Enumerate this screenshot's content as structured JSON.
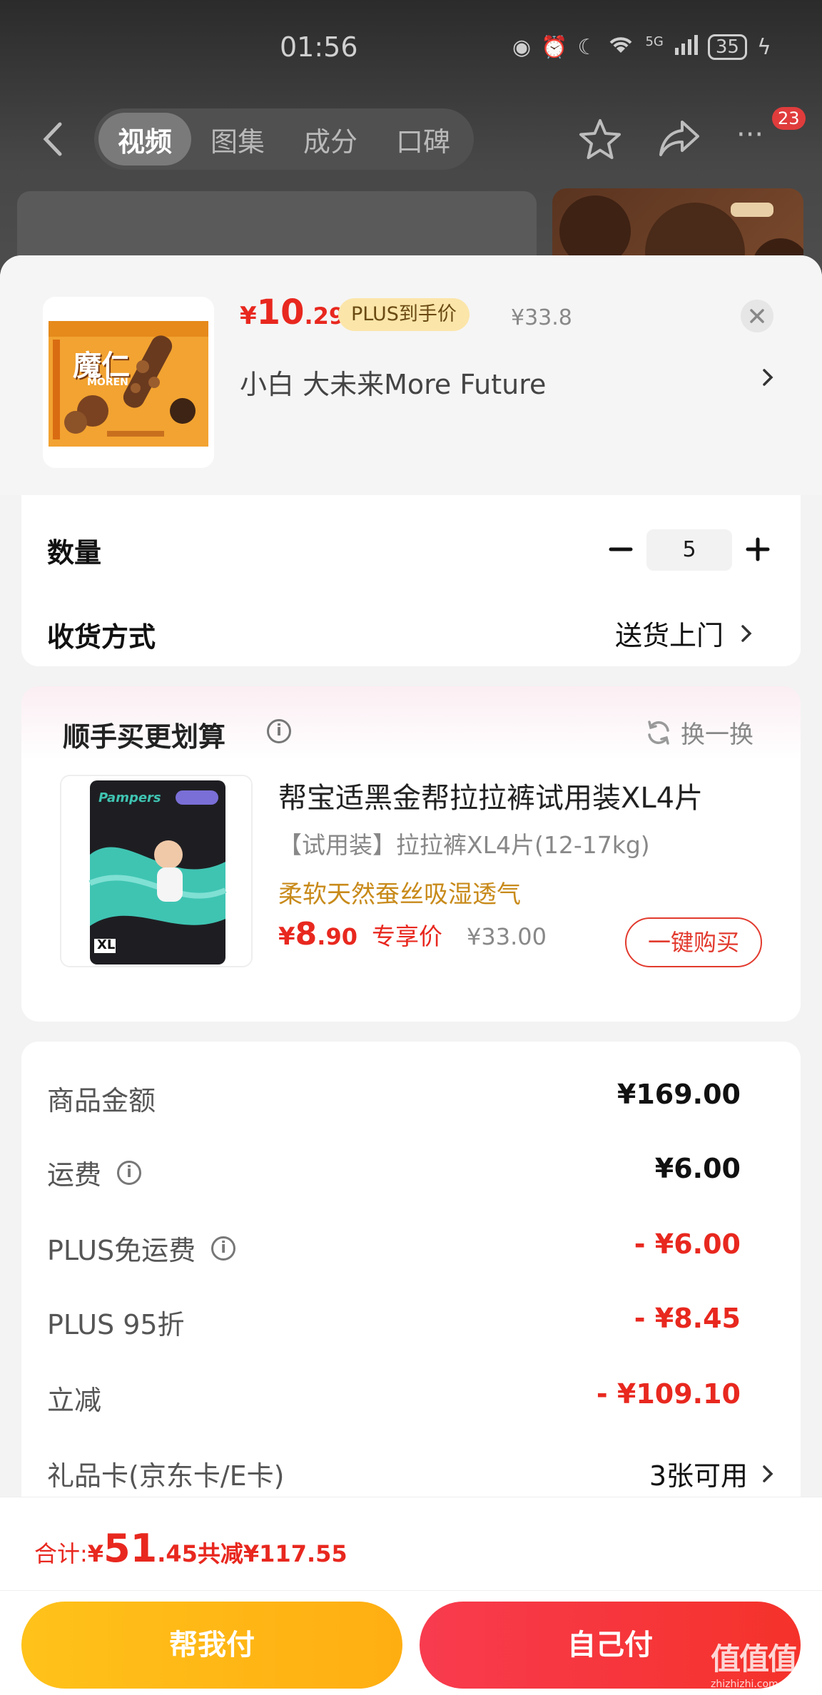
{
  "status_bar": {
    "time": "01:56",
    "battery": "35",
    "network": "5G"
  },
  "nav": {
    "tabs": [
      {
        "label": "视频",
        "active": true
      },
      {
        "label": "图集",
        "active": false
      },
      {
        "label": "成分",
        "active": false
      },
      {
        "label": "口碑",
        "active": false
      }
    ],
    "badge_count": "23"
  },
  "product": {
    "price_currency": "¥",
    "price_int": "10",
    "price_dec": ".29",
    "plus_tag": "PLUS到手价",
    "original_price": "¥33.8",
    "shop": "小白  大未来More Future",
    "image_brand": "魔仁",
    "image_brand_en": "MOREN"
  },
  "order": {
    "quantity_label": "数量",
    "quantity_value": "5",
    "delivery_label": "收货方式",
    "delivery_value": "送货上门"
  },
  "recommend": {
    "title": "顺手买更划算",
    "swap_label": "换一换",
    "item": {
      "name": "帮宝适黑金帮拉拉裤试用装XL4片",
      "spec": "【试用装】拉拉裤XL4片(12-17kg)",
      "feature": "柔软天然蚕丝吸湿透气",
      "price_currency": "¥",
      "price_int": "8",
      "price_dec": ".90",
      "exclusive_label": "专享价",
      "original_price": "¥33.00",
      "buy_label": "一键购买",
      "image_brand": "Pampers",
      "image_size": "XL"
    }
  },
  "costs": [
    {
      "label": "商品金额",
      "value": "¥169.00",
      "info": false,
      "red": false
    },
    {
      "label": "运费",
      "value": "¥6.00",
      "info": true,
      "red": false
    },
    {
      "label": "PLUS免运费",
      "value": "- ¥6.00",
      "info": true,
      "red": true
    },
    {
      "label": "PLUS 95折",
      "value": "- ¥8.45",
      "info": false,
      "red": true
    },
    {
      "label": "立减",
      "value": "- ¥109.10",
      "info": false,
      "red": true
    }
  ],
  "gift_card": {
    "label": "礼品卡(京东卡/E卡)",
    "value": "3张可用"
  },
  "total": {
    "label": "合计: ",
    "currency": "¥",
    "int": "51",
    "dec": ".45",
    "saved": " 共减¥117.55"
  },
  "buttons": {
    "help_pay": "帮我付",
    "self_pay": "自己付"
  },
  "watermark": "值值值",
  "watermark_url": "zhizhizhi.com",
  "colors": {
    "accent_red": "#e8281f",
    "gold": "#ffc21a",
    "plus_tag_bg": "#fbe5a9"
  }
}
